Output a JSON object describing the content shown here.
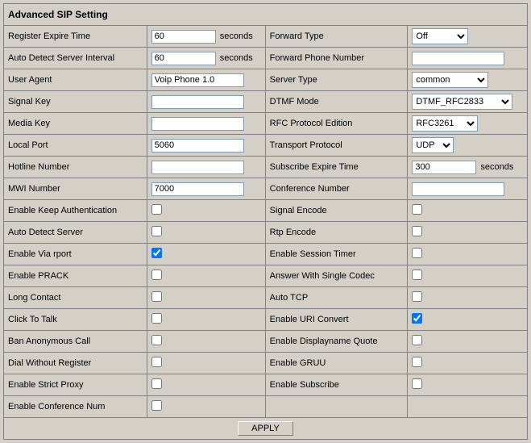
{
  "header": "Advanced SIP Setting",
  "units": {
    "seconds": "seconds"
  },
  "left": {
    "register_expire_time": {
      "label": "Register Expire Time",
      "value": "60"
    },
    "auto_detect_interval": {
      "label": "Auto Detect Server Interval",
      "value": "60"
    },
    "user_agent": {
      "label": "User Agent",
      "value": "Voip Phone 1.0"
    },
    "signal_key": {
      "label": "Signal Key",
      "value": ""
    },
    "media_key": {
      "label": "Media Key",
      "value": ""
    },
    "local_port": {
      "label": "Local Port",
      "value": "5060"
    },
    "hotline_number": {
      "label": "Hotline Number",
      "value": ""
    },
    "mwi_number": {
      "label": "MWI Number",
      "value": "7000"
    },
    "enable_keep_auth": {
      "label": "Enable Keep Authentication",
      "checked": false
    },
    "auto_detect_server": {
      "label": "Auto Detect Server",
      "checked": false
    },
    "enable_via_rport": {
      "label": "Enable Via rport",
      "checked": true
    },
    "enable_prack": {
      "label": "Enable PRACK",
      "checked": false
    },
    "long_contact": {
      "label": "Long Contact",
      "checked": false
    },
    "click_to_talk": {
      "label": "Click To Talk",
      "checked": false
    },
    "ban_anonymous": {
      "label": "Ban Anonymous Call",
      "checked": false
    },
    "dial_without_register": {
      "label": "Dial Without Register",
      "checked": false
    },
    "enable_strict_proxy": {
      "label": "Enable Strict Proxy",
      "checked": false
    },
    "enable_conference_num": {
      "label": "Enable Conference Num",
      "checked": false
    }
  },
  "right": {
    "forward_type": {
      "label": "Forward Type",
      "value": "Off"
    },
    "forward_phone_number": {
      "label": "Forward Phone Number",
      "value": ""
    },
    "server_type": {
      "label": "Server Type",
      "value": "common"
    },
    "dtmf_mode": {
      "label": "DTMF Mode",
      "value": "DTMF_RFC2833"
    },
    "rfc_protocol_edition": {
      "label": "RFC Protocol Edition",
      "value": "RFC3261"
    },
    "transport_protocol": {
      "label": "Transport Protocol",
      "value": "UDP"
    },
    "subscribe_expire_time": {
      "label": "Subscribe Expire Time",
      "value": "300"
    },
    "conference_number": {
      "label": "Conference Number",
      "value": ""
    },
    "signal_encode": {
      "label": "Signal Encode",
      "checked": false
    },
    "rtp_encode": {
      "label": "Rtp Encode",
      "checked": false
    },
    "enable_session_timer": {
      "label": "Enable Session Timer",
      "checked": false
    },
    "answer_single_codec": {
      "label": "Answer With Single Codec",
      "checked": false
    },
    "auto_tcp": {
      "label": "Auto TCP",
      "checked": false
    },
    "enable_uri_convert": {
      "label": "Enable URI Convert",
      "checked": true
    },
    "enable_displayname_q": {
      "label": "Enable Displayname Quote",
      "checked": false
    },
    "enable_gruu": {
      "label": "Enable GRUU",
      "checked": false
    },
    "enable_subscribe": {
      "label": "Enable Subscribe",
      "checked": false
    }
  },
  "buttons": {
    "apply": "APPLY"
  }
}
